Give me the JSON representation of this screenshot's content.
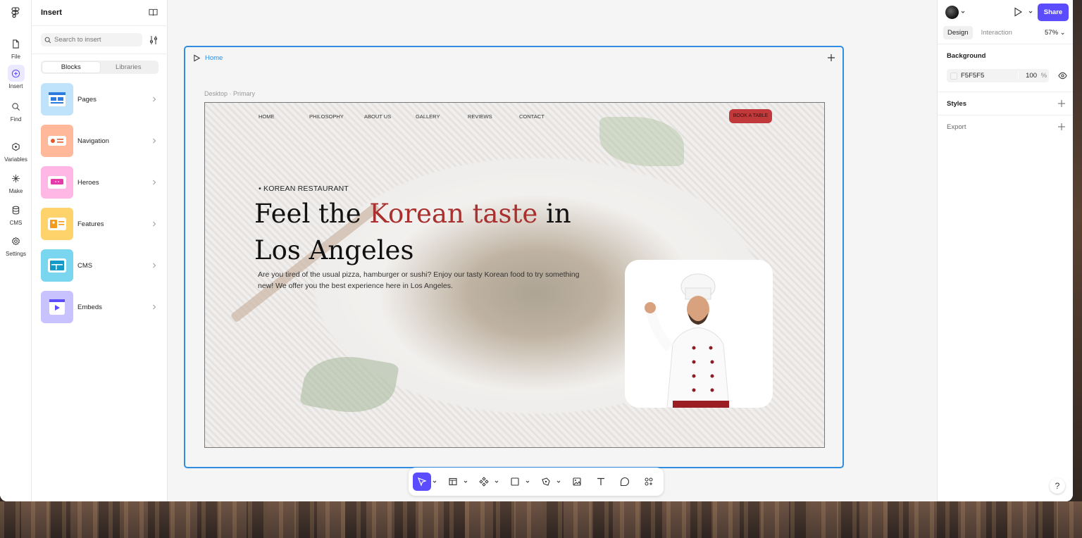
{
  "rail": {
    "items": [
      {
        "label": "File",
        "icon": "file-icon"
      },
      {
        "label": "Insert",
        "icon": "insert-icon"
      },
      {
        "label": "Find",
        "icon": "search-icon"
      },
      {
        "label": "Variables",
        "icon": "variables-icon"
      },
      {
        "label": "Make",
        "icon": "make-icon"
      },
      {
        "label": "CMS",
        "icon": "database-icon"
      },
      {
        "label": "Settings",
        "icon": "gear-icon"
      }
    ]
  },
  "insert": {
    "title": "Insert",
    "search_placeholder": "Search to insert",
    "tabs": [
      "Blocks",
      "Libraries"
    ],
    "categories": [
      {
        "label": "Pages",
        "color": "#bfe3fb"
      },
      {
        "label": "Navigation",
        "color": "#ffb99a"
      },
      {
        "label": "Heroes",
        "color": "#ffb7e6"
      },
      {
        "label": "Features",
        "color": "#ffd36b"
      },
      {
        "label": "CMS",
        "color": "#7ad6ee"
      },
      {
        "label": "Embeds",
        "color": "#c8c2ff"
      }
    ]
  },
  "canvas": {
    "frame_title": "Home",
    "breakpoint_label": "Desktop · Primary",
    "site": {
      "nav": [
        "HOME",
        "PHILOSOPHY",
        "ABOUT US",
        "GALLERY",
        "REVIEWS",
        "CONTACT"
      ],
      "cta": "BOOK A TABLE",
      "eyebrow": "•  KOREAN RESTAURANT",
      "headline_pre": "Feel the ",
      "headline_accent": "Korean taste",
      "headline_post": " in Los Angeles",
      "blurb": "Are you tired of the usual pizza, hamburger or sushi? Enjoy our tasty Korean food to try something new! We offer you the best experience here in Los Angeles.",
      "accent_color": "#a8302e"
    }
  },
  "toolbar": {
    "tools": [
      "select-tool",
      "frame-tool",
      "component-tool",
      "shape-tool",
      "pen-tool",
      "image-tool",
      "text-tool",
      "comment-tool",
      "insert-tool"
    ]
  },
  "right": {
    "share": "Share",
    "tabs": [
      "Design",
      "Interaction"
    ],
    "zoom": "57% ⌄",
    "background_label": "Background",
    "background_hex": "F5F5F5",
    "background_opacity": "100",
    "background_pct": "%",
    "styles_label": "Styles",
    "export_label": "Export",
    "help": "?"
  }
}
